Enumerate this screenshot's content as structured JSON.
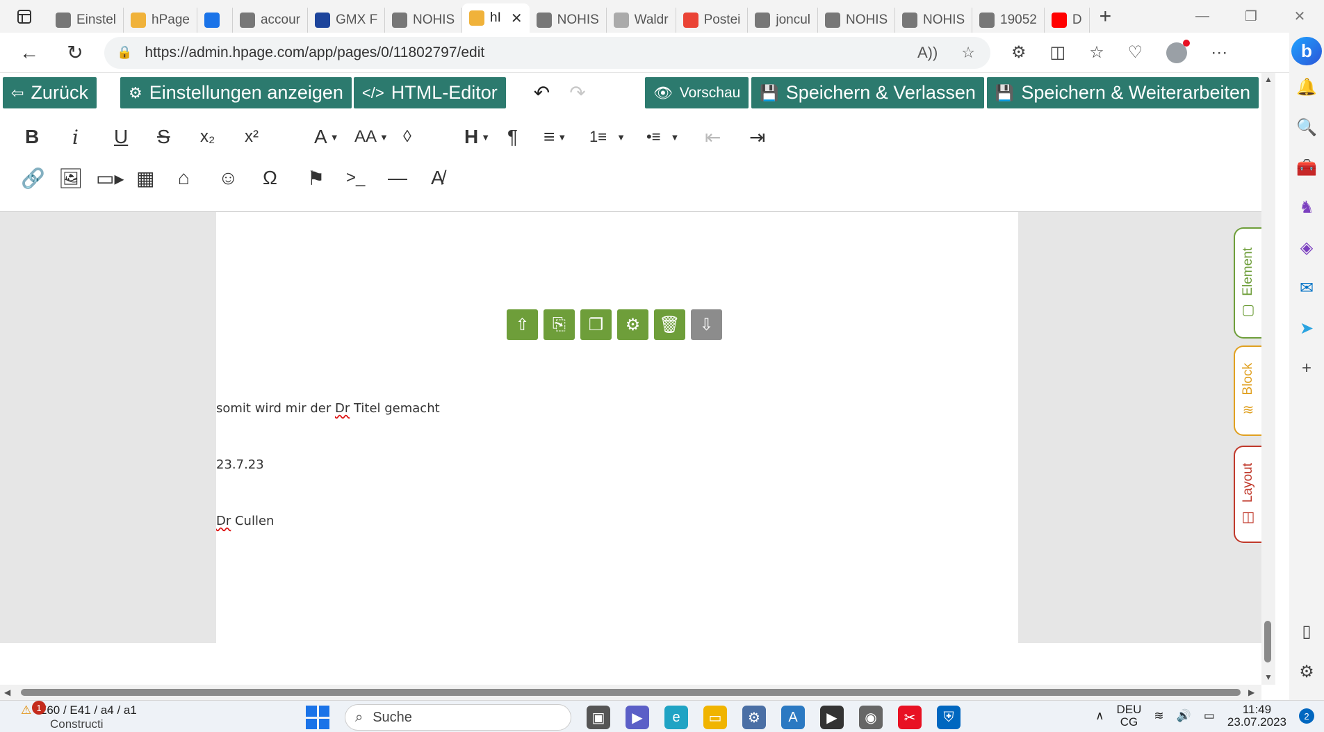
{
  "browser": {
    "tabs": [
      {
        "label": "Einstel",
        "favicon": "gear-icon",
        "color": "#777777"
      },
      {
        "label": "hPage",
        "favicon": "hpage-icon",
        "color": "#f0b23a"
      },
      {
        "label": "",
        "favicon": "blue-app-icon",
        "color": "#1a73e8"
      },
      {
        "label": "accour",
        "favicon": "doc-icon",
        "color": "#777777"
      },
      {
        "label": "GMX F",
        "favicon": "gmx-icon",
        "color": "#1c449b"
      },
      {
        "label": "NOHIS",
        "favicon": "doc-icon",
        "color": "#777777"
      },
      {
        "label": "hI",
        "favicon": "hpage-icon",
        "color": "#f0b23a",
        "active": true
      },
      {
        "label": "NOHIS",
        "favicon": "doc-icon",
        "color": "#777777"
      },
      {
        "label": "Waldr",
        "favicon": "zooplus-icon",
        "color": "#aaaaaa"
      },
      {
        "label": "Postei",
        "favicon": "gmail-icon",
        "color": "#ea4335"
      },
      {
        "label": "joncul",
        "favicon": "doc-icon",
        "color": "#777777"
      },
      {
        "label": "NOHIS",
        "favicon": "doc-icon",
        "color": "#777777"
      },
      {
        "label": "NOHIS",
        "favicon": "doc-icon",
        "color": "#777777"
      },
      {
        "label": "19052",
        "favicon": "doc-icon",
        "color": "#777777"
      },
      {
        "label": "D",
        "favicon": "youtube-icon",
        "color": "#ff0000"
      }
    ],
    "new_tab": "+",
    "url": "https://admin.hpage.com/app/pages/0/11802797/edit"
  },
  "hpage_toolbar": {
    "back_label": "Zurück",
    "settings_label": "Einstellungen anzeigen",
    "html_editor_label": "HTML-Editor",
    "preview_label": "Vorschau",
    "save_exit_label": "Speichern & Verlassen",
    "save_continue_label": "Speichern & Weiterarbeiten",
    "button_color": "#2c7a6e"
  },
  "format_toolbar": {
    "row1": [
      "B",
      "i",
      "U",
      "S",
      "x₂",
      "x²",
      "A",
      "AA",
      "💧",
      "H",
      "¶",
      "≡",
      "1≡",
      "•≡",
      "⇤",
      "⇥"
    ],
    "row2": [
      "link-icon",
      "image-icon",
      "video-icon",
      "table-icon",
      "tag-icon",
      "emoji-icon",
      "Ω",
      "flag-icon",
      ">_",
      "—",
      "clear-format-icon"
    ]
  },
  "page": {
    "lines": [
      {
        "text": "somit wird mir der Dr Titel gemacht"
      },
      {
        "text": "23.7.23"
      },
      {
        "text": "Dr Cullen"
      }
    ],
    "block_tools": [
      "move-up-icon",
      "export-icon",
      "copy-icon",
      "settings-icon",
      "delete-icon",
      "move-down-icon"
    ],
    "accent": "#6e9e3a"
  },
  "side_tabs": [
    {
      "label": "Element",
      "color": "#6e9e3a"
    },
    {
      "label": "Block",
      "color": "#e0a020"
    },
    {
      "label": "Layout",
      "color": "#c0392b"
    }
  ],
  "taskbar": {
    "weather_line1": "E60 / E41 / a4 / a1",
    "weather_line2": "Constructi",
    "weather_badge": "1",
    "search_placeholder": "Suche",
    "lang": "DEU",
    "lang_sub": "CG",
    "time": "11:49",
    "date": "23.07.2023",
    "notifications": "2"
  }
}
